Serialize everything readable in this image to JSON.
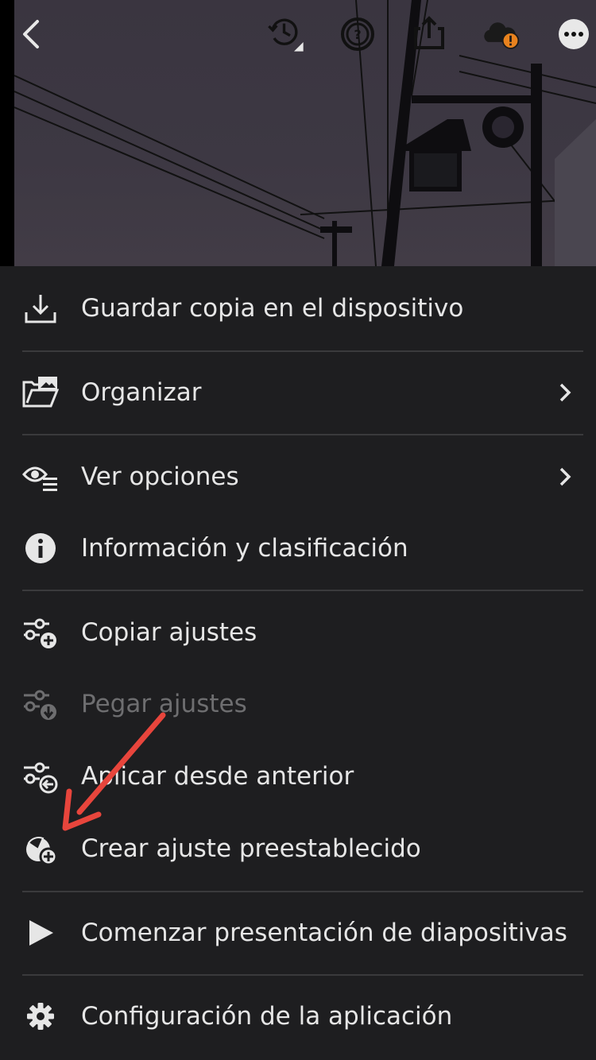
{
  "toolbar": {
    "back": "back-icon",
    "history": "history-icon",
    "help": "help-icon",
    "share": "share-icon",
    "cloud": "cloud-warning-icon",
    "more": "more-icon",
    "cloud_badge_color": "#e8821e"
  },
  "menu": {
    "items": [
      {
        "label": "Guardar copia en el dispositivo",
        "icon": "download-icon"
      },
      {
        "label": "Organizar",
        "icon": "organize-folder-icon",
        "has_submenu": true
      },
      {
        "label": "Ver opciones",
        "icon": "view-options-icon",
        "has_submenu": true
      },
      {
        "label": "Información y clasificación",
        "icon": "info-icon"
      },
      {
        "label": "Copiar ajustes",
        "icon": "copy-settings-icon"
      },
      {
        "label": "Pegar ajustes",
        "icon": "paste-settings-icon",
        "disabled": true
      },
      {
        "label": "Aplicar desde anterior",
        "icon": "apply-previous-icon"
      },
      {
        "label": "Crear ajuste preestablecido",
        "icon": "create-preset-icon"
      },
      {
        "label": "Comenzar presentación de diapositivas",
        "icon": "play-icon"
      },
      {
        "label": "Configuración de la aplicación",
        "icon": "gear-icon"
      }
    ]
  },
  "colors": {
    "background": "#1e1e20",
    "text": "#e6e6e6",
    "disabled_text": "#6e6e70",
    "separator": "#3a3a3c",
    "annotation_arrow": "#e8453c"
  }
}
